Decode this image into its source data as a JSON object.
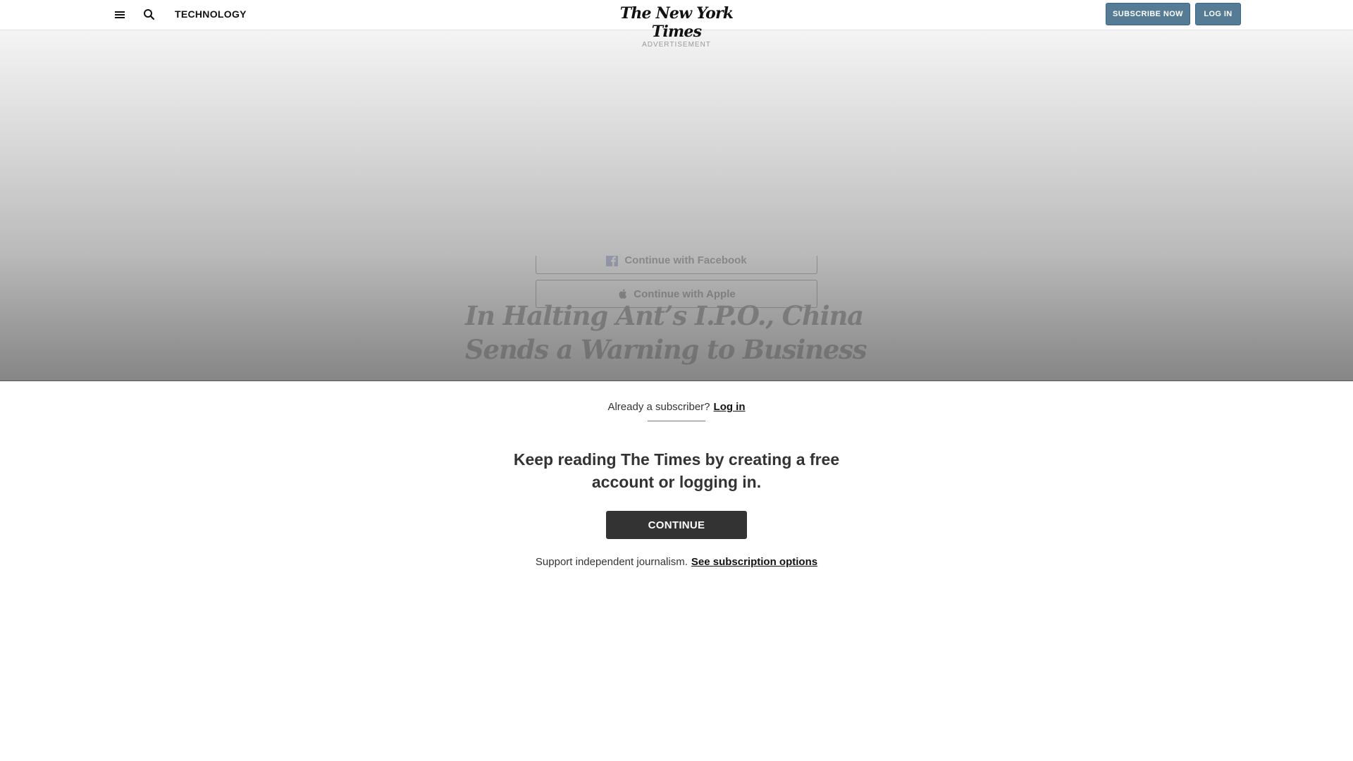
{
  "header": {
    "section": "TECHNOLOGY",
    "logo": "The New York Times",
    "subscribe_label": "SUBSCRIBE NOW",
    "login_label": "LOG IN"
  },
  "ad": {
    "label": "ADVERTISEMENT"
  },
  "social": {
    "facebook_label": "Continue with Facebook",
    "apple_label": "Continue with Apple"
  },
  "article": {
    "headline": "In Halting Ant’s I.P.O., China Sends a Warning to Business"
  },
  "paywall": {
    "already_text": "Already a subscriber?",
    "login_link": "Log in",
    "keep_reading": "Keep reading The Times by creating a free account or logging in.",
    "continue_label": "CONTINUE",
    "support_text": "Support independent journalism.",
    "subscription_link": "See subscription options"
  },
  "colors": {
    "header_buttons": "#567b95",
    "continue_button": "#333333",
    "facebook_blue": "#3b5998"
  }
}
